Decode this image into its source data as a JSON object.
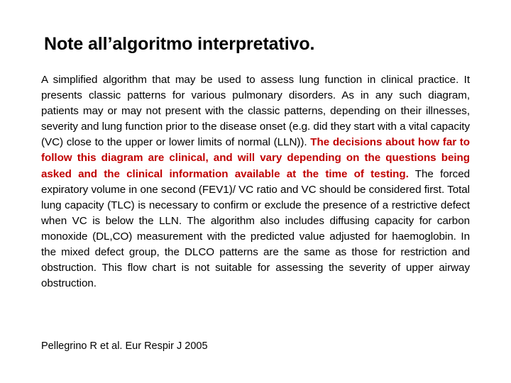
{
  "slide": {
    "title": "Note all’algoritmo interpretativo.",
    "background_color": "#FFFFFF",
    "text_color": "#000000",
    "accent_color": "#C00000",
    "body": {
      "part1": "A simplified algorithm that may be used to assess lung function in clinical practice. It presents classic patterns for various pulmonary disorders. As in any such diagram, patients may or may not present with the classic patterns, depending on their illnesses, severity and lung function prior to the disease onset (e.g. did they start with a vital capacity (VC) close to the upper or lower limits of normal (LLN)). ",
      "part2_red": "The decisions about how far to follow this diagram are clinical, and will vary depending on the questions being asked and the clinical information available at the time of testing.",
      "part3": " The forced expiratory volume in one second (FEV1)/ VC ratio and VC should be considered first. Total lung capacity (TLC) is necessary to confirm or exclude the presence of a restrictive defect when VC is below the LLN. The algorithm also includes diffusing capacity for carbon monoxide (DL,CO) measurement with the predicted value adjusted for haemoglobin. In the mixed defect group, the DLCO patterns are the same as those for restriction and obstruction. This flow chart is not suitable for assessing the severity of upper airway obstruction."
    },
    "citation": "Pellegrino R et al. Eur Respir J 2005"
  }
}
